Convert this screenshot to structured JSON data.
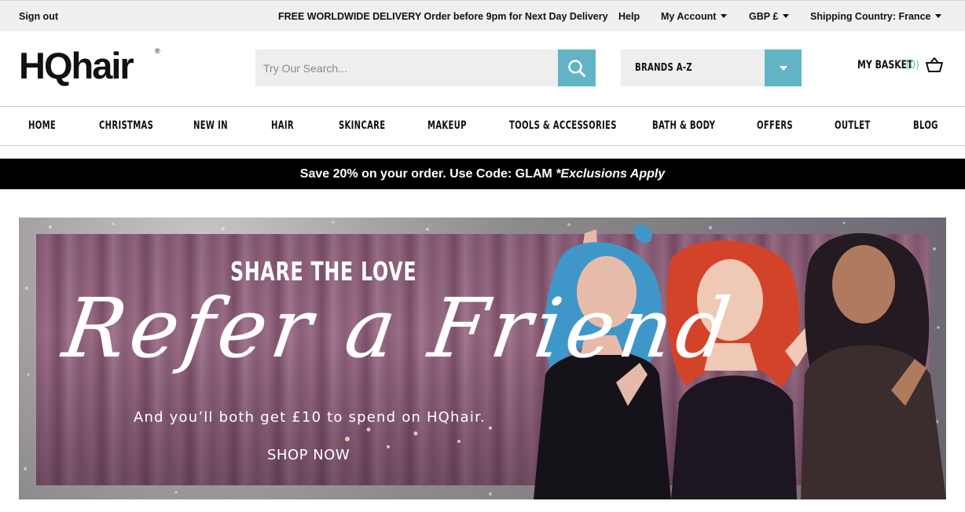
{
  "topbar": {
    "sign_out": "Sign out",
    "delivery": "FREE WORLDWIDE DELIVERY Order before 9pm for Next Day Delivery",
    "help": "Help",
    "my_account": "My Account",
    "currency": "GBP £",
    "shipping_country": "Shipping Country: France"
  },
  "header": {
    "logo": "HQhair",
    "logo_mark": "®",
    "search_placeholder": "Try Our Search...",
    "brands_label": "BRANDS A-Z",
    "basket_label": "MY BASKET",
    "basket_count": "(0)"
  },
  "nav": {
    "items": [
      "HOME",
      "CHRISTMAS",
      "NEW IN",
      "HAIR",
      "SKINCARE",
      "MAKEUP",
      "TOOLS & ACCESSORIES",
      "BATH & BODY",
      "OFFERS",
      "OUTLET",
      "BLOG"
    ]
  },
  "promo": {
    "text": "Save 20% on your order.  Use Code: GLAM ",
    "note": "*Exclusions Apply"
  },
  "hero": {
    "kicker": "SHARE THE LOVE",
    "title": "Refer a Friend",
    "subtitle": "And you’ll both get £10 to spend on HQhair.",
    "cta": "SHOP NOW"
  },
  "colors": {
    "accent": "#62b3c6",
    "topbar_bg": "#efefef",
    "promo_bg": "#000000"
  },
  "icons": {
    "search": "search-icon",
    "basket": "basket-icon",
    "dropdown": "chevron-down-icon"
  }
}
